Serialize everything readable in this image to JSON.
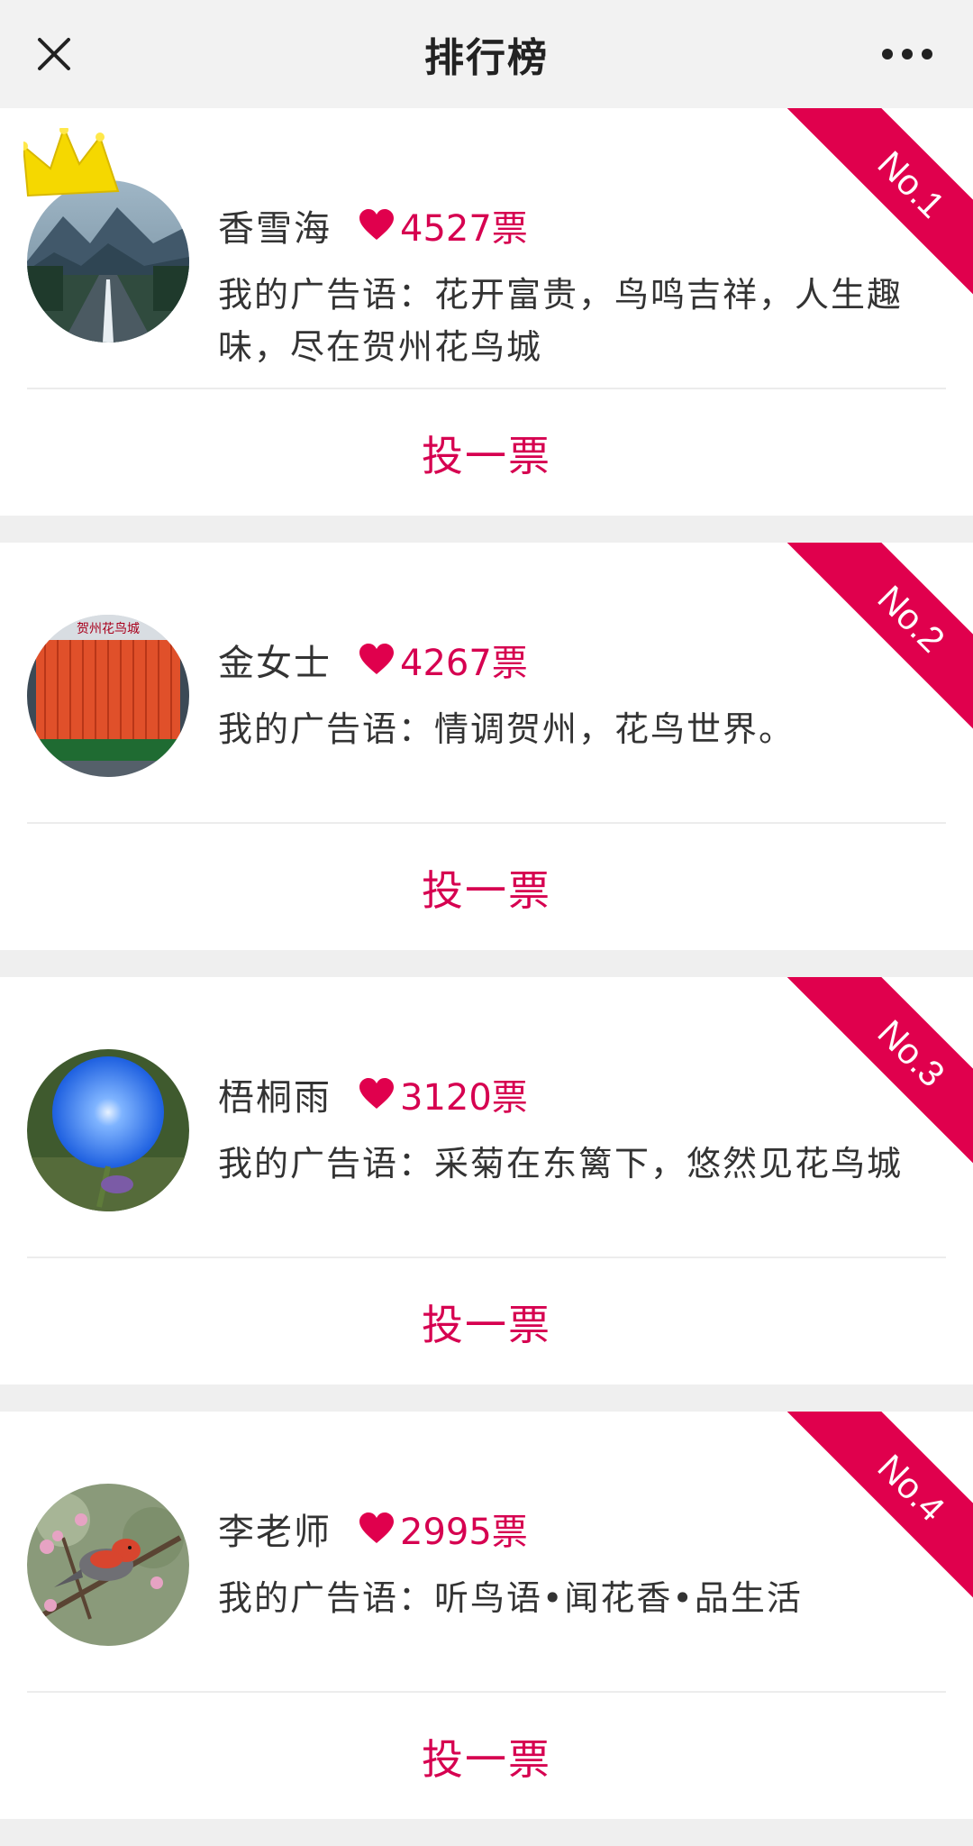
{
  "header": {
    "title": "排行榜",
    "close_icon": "close-icon",
    "more_icon": "more-dots-icon"
  },
  "colors": {
    "accent": "#d60050",
    "ribbon": "#e0004d",
    "page_bg": "#efefef",
    "card_bg": "#ffffff"
  },
  "entries": [
    {
      "rank": "No.1",
      "name": "香雪海",
      "votes": "4527票",
      "slogan": "我的广告语：花开富贵，鸟鸣吉祥，人生趣味，尽在贺州花鸟城",
      "vote_label": "投一票",
      "avatar": "mountain-road-photo",
      "crown": true
    },
    {
      "rank": "No.2",
      "name": "金女士",
      "votes": "4267票",
      "slogan": "我的广告语：情调贺州，花鸟世界。",
      "vote_label": "投一票",
      "avatar": "flower-market-building-photo",
      "avatar_text": "贺州花鸟城",
      "crown": false
    },
    {
      "rank": "No.3",
      "name": "梧桐雨",
      "votes": "3120票",
      "slogan": "我的广告语：采菊在东篱下，悠然见花鸟城",
      "vote_label": "投一票",
      "avatar": "blue-morning-glory-photo",
      "crown": false
    },
    {
      "rank": "No.4",
      "name": "李老师",
      "votes": "2995票",
      "slogan": "我的广告语：听鸟语•闻花香•品生活",
      "vote_label": "投一票",
      "avatar": "bird-on-blossom-branch-photo",
      "crown": false
    }
  ]
}
